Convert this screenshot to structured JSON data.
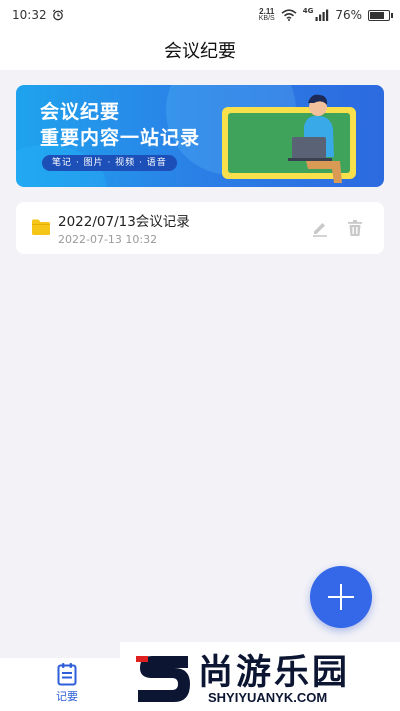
{
  "status_bar": {
    "time": "10:32",
    "net_speed_value": "2.11",
    "net_speed_unit": "KB/S",
    "network_type": "4G",
    "battery_percent": "76%",
    "battery_level": 0.76,
    "icons": [
      "alarm-icon",
      "wifi-icon",
      "signal-icon",
      "battery-icon"
    ]
  },
  "header": {
    "title": "会议纪要"
  },
  "banner": {
    "title_line1": "会议纪要",
    "title_line2": "重要内容一站记录",
    "tags": "笔记 · 图片 · 视频 · 语音"
  },
  "notes": [
    {
      "title": "2022/07/13会议记录",
      "time": "2022-07-13 10:32",
      "icons": [
        "folder-icon",
        "edit-icon",
        "delete-icon"
      ]
    }
  ],
  "fab": {
    "icon": "plus-icon"
  },
  "tab_bar": {
    "tabs": [
      {
        "label": "记要",
        "icon": "notes-icon",
        "active": true
      }
    ]
  },
  "watermark": {
    "text": "尚游乐园",
    "url": "SHYIYUANYK.COM"
  },
  "colors": {
    "accent": "#3468e8",
    "background": "#f2f2f7",
    "card": "#ffffff",
    "folder": "#f5c518",
    "muted_text": "#9a9a9a"
  }
}
